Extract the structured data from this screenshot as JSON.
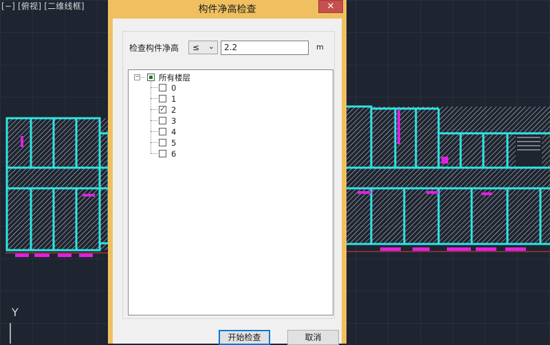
{
  "viewport": {
    "label": "[−] [俯视] [二维线框]",
    "axis_label": "Y"
  },
  "dialog": {
    "title": "构件净高检查",
    "close_glyph": "✕",
    "height_label": "检查构件净高",
    "operator": {
      "selected": "≤"
    },
    "height_value": "2.2",
    "unit": "m",
    "tree": {
      "root": {
        "label": "所有楼层",
        "state": "partial"
      },
      "floors": [
        {
          "label": "0",
          "checked": false
        },
        {
          "label": "1",
          "checked": false
        },
        {
          "label": "2",
          "checked": true
        },
        {
          "label": "3",
          "checked": false
        },
        {
          "label": "4",
          "checked": false
        },
        {
          "label": "5",
          "checked": false
        },
        {
          "label": "6",
          "checked": false
        }
      ]
    },
    "buttons": {
      "start": "开始检查",
      "cancel": "取消"
    }
  },
  "colors": {
    "dialog_frame": "#f0c060",
    "close_button": "#c74f4f",
    "wall": "#2ee6e6",
    "hatch": "#d8d8d8",
    "dim_magenta": "#e020e0"
  }
}
